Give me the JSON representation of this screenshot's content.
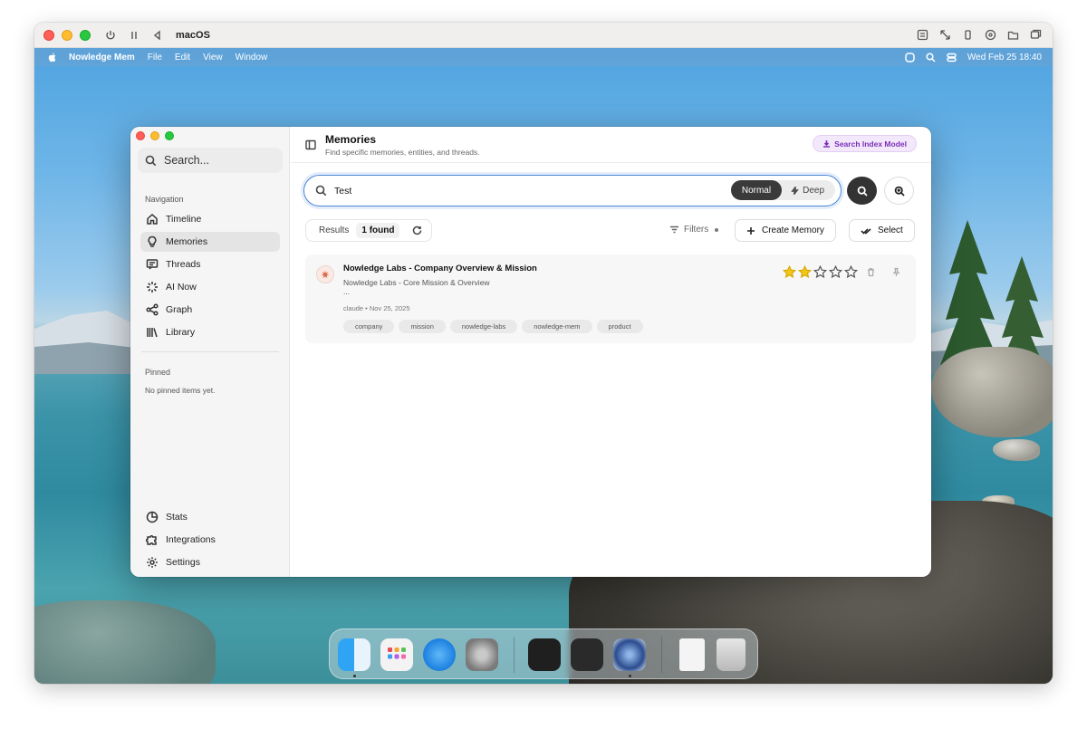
{
  "vm": {
    "title": "macOS"
  },
  "menubar": {
    "app_name": "Nowledge Mem",
    "menus": [
      "File",
      "Edit",
      "View",
      "Window"
    ],
    "clock": "Wed Feb 25  18:40"
  },
  "sidebar": {
    "search_placeholder": "Search...",
    "navigation_heading": "Navigation",
    "items": [
      {
        "label": "Timeline",
        "icon": "home-icon"
      },
      {
        "label": "Memories",
        "icon": "lightbulb-icon"
      },
      {
        "label": "Threads",
        "icon": "chat-icon"
      },
      {
        "label": "AI Now",
        "icon": "sparkle-icon"
      },
      {
        "label": "Graph",
        "icon": "share-icon"
      },
      {
        "label": "Library",
        "icon": "library-icon"
      }
    ],
    "pinned_heading": "Pinned",
    "pinned_empty": "No pinned items yet.",
    "bottom_items": [
      {
        "label": "Stats",
        "icon": "pie-chart-icon"
      },
      {
        "label": "Integrations",
        "icon": "puzzle-icon"
      },
      {
        "label": "Settings",
        "icon": "gear-icon"
      }
    ]
  },
  "header": {
    "title": "Memories",
    "subtitle": "Find specific memories, entities, and threads.",
    "index_button": "Search Index Model"
  },
  "search": {
    "value": "Test",
    "mode_normal": "Normal",
    "mode_deep": "Deep",
    "active_mode": "Normal"
  },
  "results": {
    "label": "Results",
    "count": "1 found",
    "filters_label": "Filters",
    "create_label": "Create Memory",
    "select_label": "Select"
  },
  "memories": [
    {
      "title": "Nowledge Labs - Company Overview & Mission",
      "subtitle": "Nowledge Labs - Core Mission & Overview",
      "ellipsis": "...",
      "meta": "claude • Nov 25, 2025",
      "rating": 2,
      "rating_max": 5,
      "tags": [
        "company",
        "mission",
        "nowledge-labs",
        "nowledge-mem",
        "product"
      ]
    }
  ],
  "colors": {
    "accent": "#4a86d8",
    "index_button": "#7a2fb8",
    "star": "#f5c518"
  }
}
